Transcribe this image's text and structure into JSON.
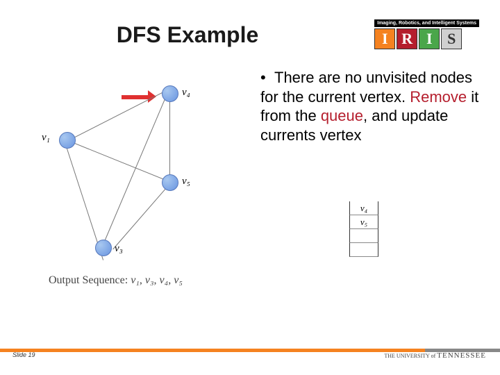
{
  "title": "DFS Example",
  "logo": {
    "subtitle": "Imaging, Robotics, and Intelligent Systems",
    "letters": [
      "I",
      "R",
      "I",
      "S"
    ]
  },
  "bullet": {
    "prefix": "There are no unvisited nodes for the current vertex. ",
    "red1": "Remove",
    "mid": " it from the ",
    "red2": "queue",
    "suffix": ", and update currents vertex"
  },
  "graph": {
    "nodes": {
      "v1": "v₁",
      "v3": "v₃",
      "v4": "v₄",
      "v5": "v₅"
    },
    "output_label": "Output Sequence:",
    "output_items": [
      "v₁",
      "v₃",
      "v₄",
      "v₅"
    ]
  },
  "stack": [
    "v₄",
    "v₅",
    "",
    ""
  ],
  "footer": {
    "slide": "Slide 19",
    "university_prefix": "THE UNIVERSITY of ",
    "university_name": "TENNESSEE"
  }
}
